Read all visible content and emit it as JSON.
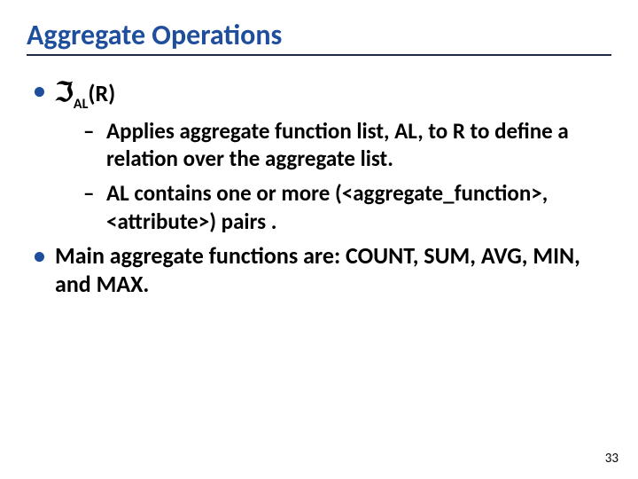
{
  "title": "Aggregate Operations",
  "bullets": {
    "formula": {
      "symbol": "ℑ",
      "subscript": "AL",
      "rest": "(R)"
    },
    "sub": [
      "Applies aggregate function list, AL, to R to define a relation over the aggregate list.",
      "AL contains one or more (<aggregate_function>, <attribute>) pairs ."
    ],
    "main2": "Main aggregate functions are: COUNT, SUM, AVG, MIN, and MAX."
  },
  "page": "33"
}
